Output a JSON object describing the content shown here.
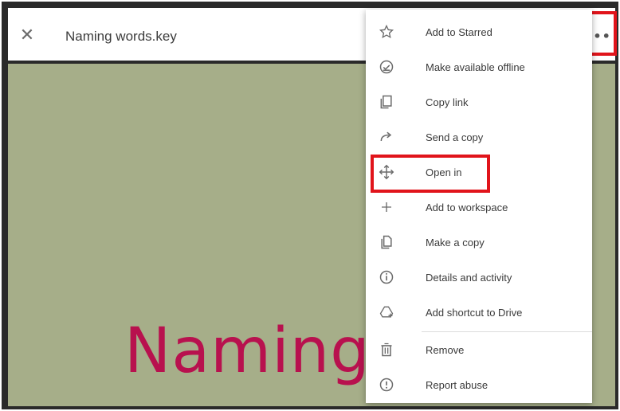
{
  "header": {
    "close_glyph": "✕",
    "title": "Naming words.key",
    "more_glyph": "•••"
  },
  "slide": {
    "text": "Naming"
  },
  "menu": {
    "items": [
      {
        "label": "Add to Starred",
        "icon": "star-icon"
      },
      {
        "label": "Make available offline",
        "icon": "offline-icon"
      },
      {
        "label": "Copy link",
        "icon": "copy-link-icon"
      },
      {
        "label": "Send a copy",
        "icon": "send-icon"
      },
      {
        "label": "Open in",
        "icon": "move-arrows-icon"
      },
      {
        "label": "Add to workspace",
        "icon": "plus-icon"
      },
      {
        "label": "Make a copy",
        "icon": "copy-icon"
      },
      {
        "label": "Details and activity",
        "icon": "info-icon"
      },
      {
        "label": "Add shortcut to Drive",
        "icon": "add-shortcut-icon"
      },
      {
        "label": "Remove",
        "icon": "trash-icon"
      },
      {
        "label": "Report abuse",
        "icon": "report-icon"
      }
    ]
  },
  "colors": {
    "slide_background": "#a6ae89",
    "slide_text": "#b8114e",
    "highlight": "#e1141b"
  }
}
